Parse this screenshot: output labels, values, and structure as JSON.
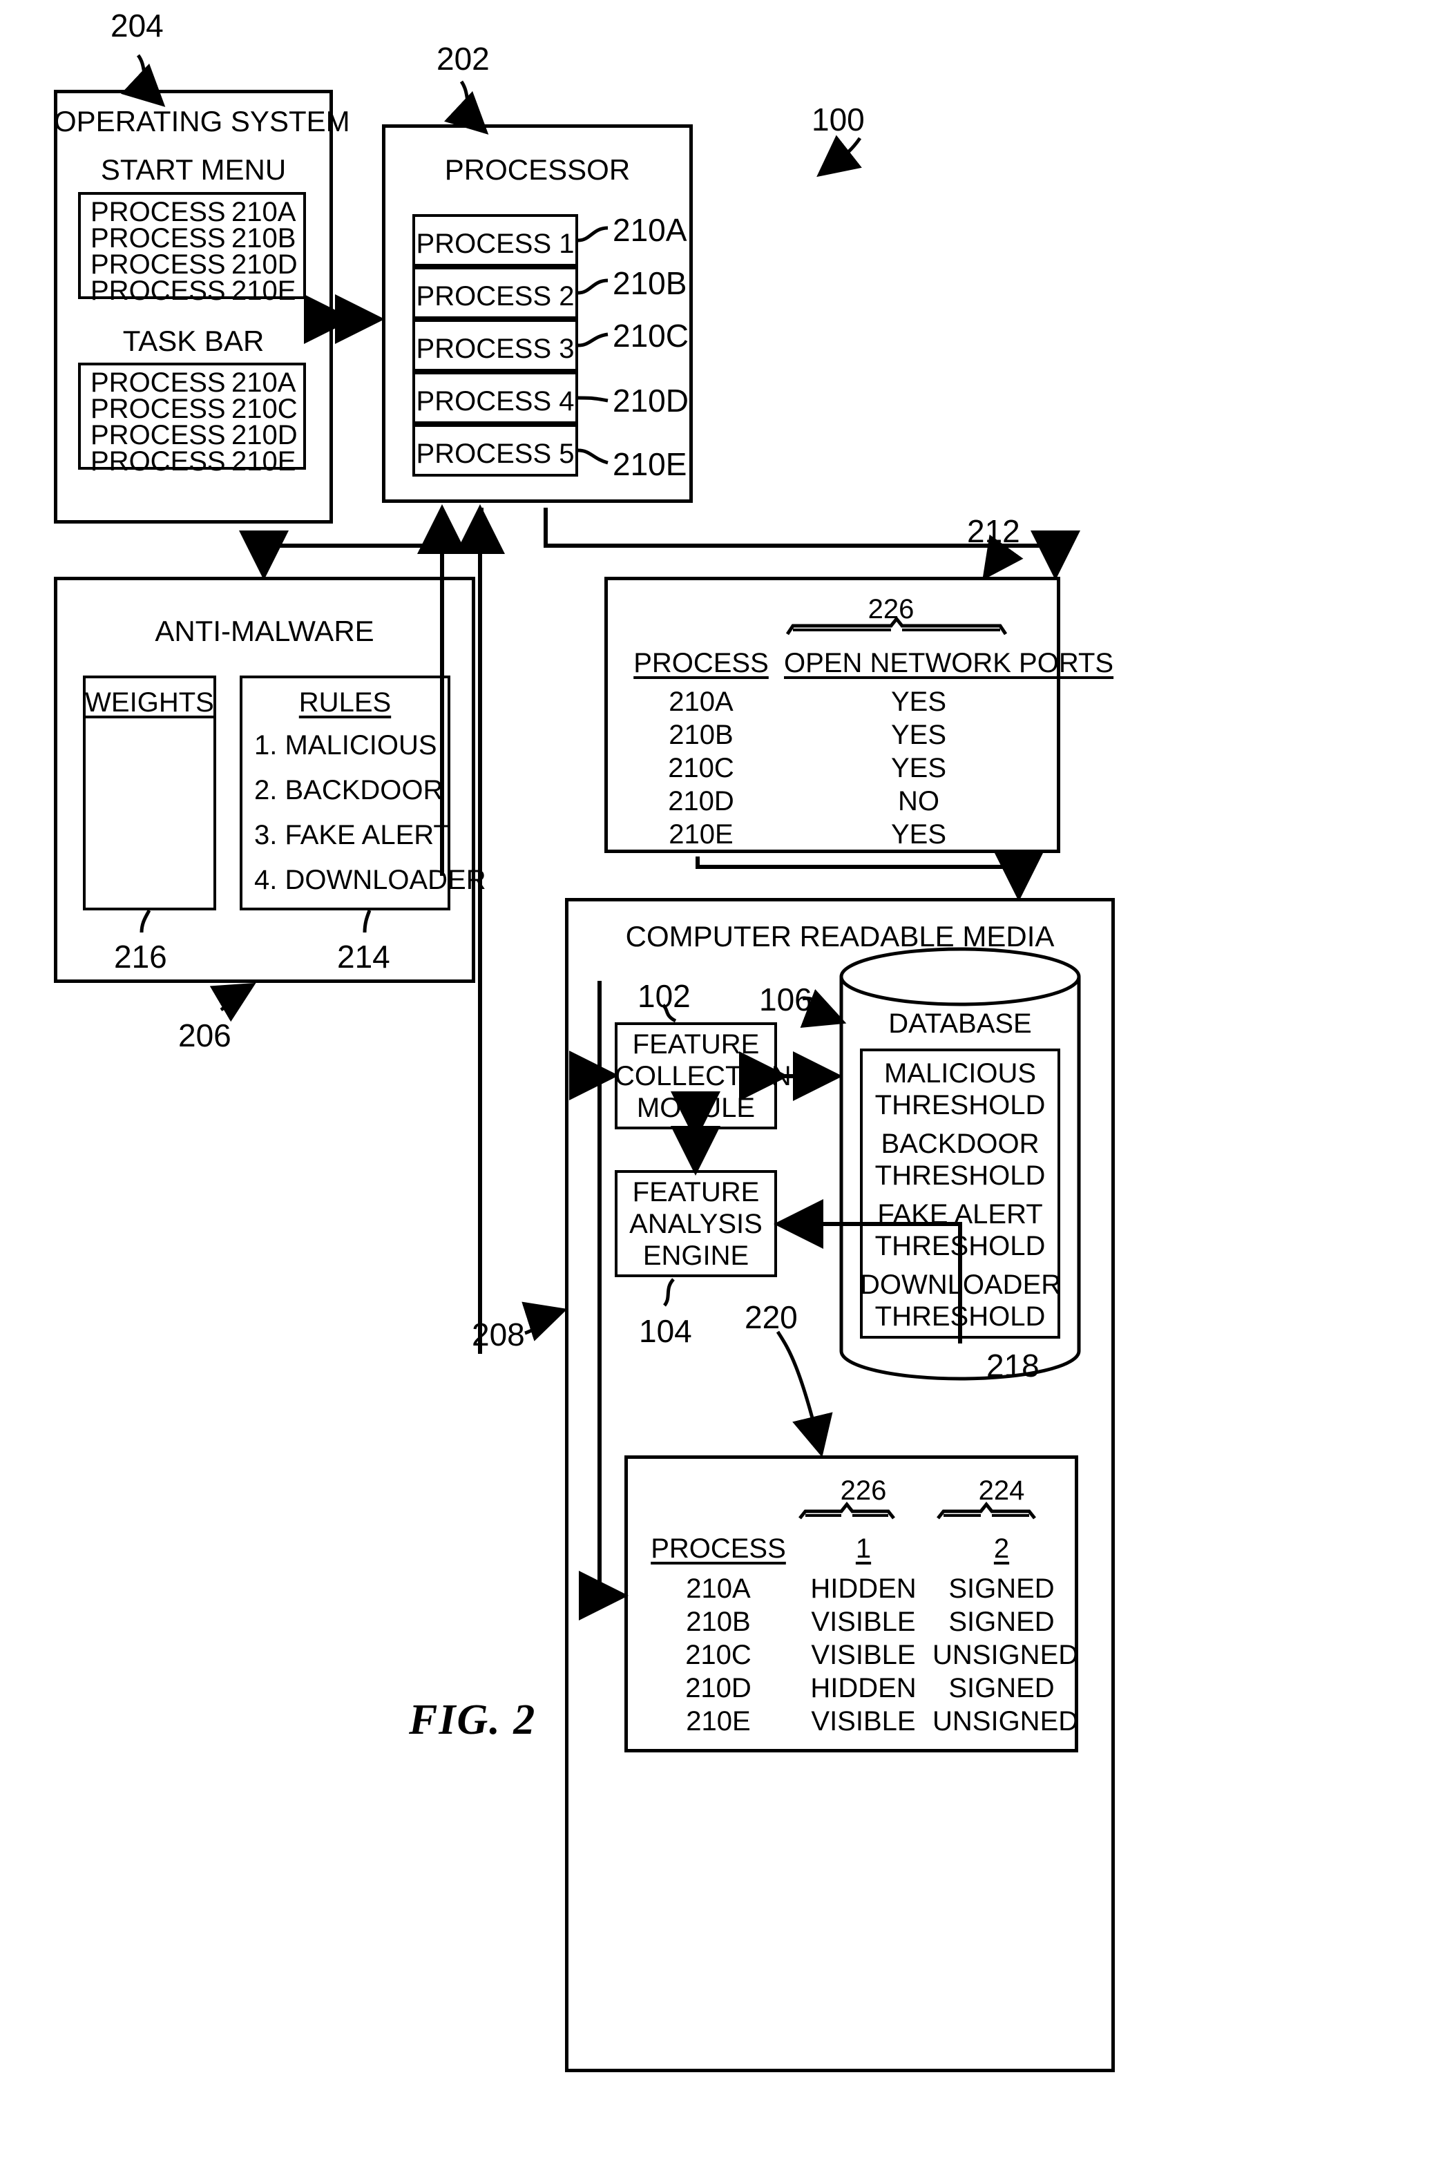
{
  "figure": {
    "caption": "FIG. 2",
    "system_ref": "100"
  },
  "operating_system": {
    "ref": "204",
    "title": "OPERATING SYSTEM",
    "start_menu": {
      "title": "START MENU",
      "rows": [
        {
          "name": "PROCESS",
          "id": "210A"
        },
        {
          "name": "PROCESS",
          "id": "210B"
        },
        {
          "name": "PROCESS",
          "id": "210D"
        },
        {
          "name": "PROCESS",
          "id": "210E"
        }
      ]
    },
    "task_bar": {
      "title": "TASK BAR",
      "rows": [
        {
          "name": "PROCESS",
          "id": "210A"
        },
        {
          "name": "PROCESS",
          "id": "210C"
        },
        {
          "name": "PROCESS",
          "id": "210D"
        },
        {
          "name": "PROCESS",
          "id": "210E"
        }
      ]
    }
  },
  "processor": {
    "ref": "202",
    "title": "PROCESSOR",
    "processes": [
      {
        "label": "PROCESS 1",
        "ref": "210A"
      },
      {
        "label": "PROCESS 2",
        "ref": "210B"
      },
      {
        "label": "PROCESS 3",
        "ref": "210C"
      },
      {
        "label": "PROCESS 4",
        "ref": "210D"
      },
      {
        "label": "PROCESS 5",
        "ref": "210E"
      }
    ]
  },
  "anti_malware": {
    "ref": "206",
    "title": "ANTI-MALWARE",
    "weights": {
      "title": "WEIGHTS",
      "ref": "216"
    },
    "rules": {
      "title": "RULES",
      "ref": "214",
      "items": [
        "1. MALICIOUS",
        "2. BACKDOOR",
        "3. FAKE ALERT",
        "4. DOWNLOADER"
      ]
    }
  },
  "ports_table": {
    "ref": "212",
    "brace_ref": "226",
    "headers": [
      "PROCESS",
      "OPEN NETWORK PORTS"
    ],
    "rows": [
      {
        "process": "210A",
        "ports": "YES"
      },
      {
        "process": "210B",
        "ports": "YES"
      },
      {
        "process": "210C",
        "ports": "YES"
      },
      {
        "process": "210D",
        "ports": "NO"
      },
      {
        "process": "210E",
        "ports": "YES"
      }
    ]
  },
  "crm": {
    "ref": "208",
    "title": "COMPUTER READABLE MEDIA",
    "feature_collection_module": {
      "ref": "102",
      "lines": [
        "FEATURE",
        "COLLECTION",
        "MODULE"
      ]
    },
    "feature_analysis_engine": {
      "ref": "104",
      "lines": [
        "FEATURE",
        "ANALYSIS",
        "ENGINE"
      ]
    },
    "database": {
      "ref_top": "106",
      "ref_bottom": "218",
      "title": "DATABASE",
      "thresholds": [
        [
          "MALICIOUS",
          "THRESHOLD"
        ],
        [
          "BACKDOOR",
          "THRESHOLD"
        ],
        [
          "FAKE ALERT",
          "THRESHOLD"
        ],
        [
          "DOWNLOADER",
          "THRESHOLD"
        ]
      ]
    },
    "features_table": {
      "ref": "220",
      "brace_ref_1": "226",
      "brace_ref_2": "224",
      "headers": [
        "PROCESS",
        "1",
        "2"
      ],
      "rows": [
        {
          "process": "210A",
          "col1": "HIDDEN",
          "col2": "SIGNED"
        },
        {
          "process": "210B",
          "col1": "VISIBLE",
          "col2": "SIGNED"
        },
        {
          "process": "210C",
          "col1": "VISIBLE",
          "col2": "UNSIGNED"
        },
        {
          "process": "210D",
          "col1": "HIDDEN",
          "col2": "SIGNED"
        },
        {
          "process": "210E",
          "col1": "VISIBLE",
          "col2": "UNSIGNED"
        }
      ]
    }
  }
}
